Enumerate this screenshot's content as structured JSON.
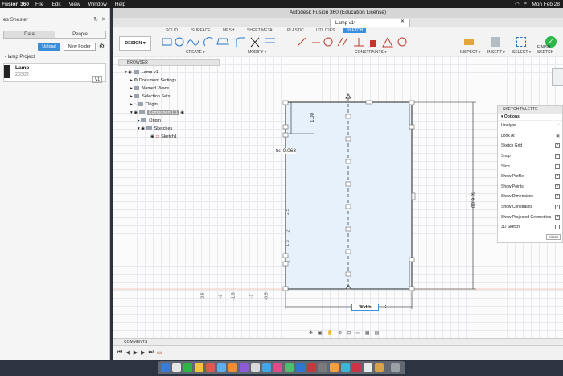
{
  "menubar": {
    "app": "Fusion 360",
    "menus": [
      "File",
      "Edit",
      "View",
      "Window",
      "Help"
    ],
    "datetime": "Mon Feb 28"
  },
  "data_panel": {
    "user": "es Shester",
    "tabs": [
      "Data",
      "People"
    ],
    "upload": "Upload",
    "new_folder": "New Folder",
    "project": "lamp Project",
    "file": {
      "name": "Lamp",
      "date": "2/23/22",
      "version": "V1"
    }
  },
  "window": {
    "title": "Autodesk Fusion 360 (Education License)",
    "doc_tab": "Lamp v1*"
  },
  "toolbar": {
    "tabs": [
      "SOLID",
      "SURFACE",
      "MESH",
      "SHEET METAL",
      "PLASTIC",
      "UTILITIES",
      "SKETCH"
    ],
    "active_tab": "SKETCH",
    "design": "DESIGN ▾",
    "groups": [
      "CREATE ▾",
      "MODIFY ▾",
      "CONSTRAINTS ▾",
      "INSPECT ▾",
      "INSERT ▾",
      "SELECT ▾",
      "FINISH SKETCH"
    ]
  },
  "browser": {
    "header": "BROWSER",
    "nodes": [
      {
        "label": "Lamp v1"
      },
      {
        "label": "Document Settings"
      },
      {
        "label": "Named Views"
      },
      {
        "label": "Selection Sets"
      },
      {
        "label": "Origin"
      },
      {
        "label": "Component1:1"
      },
      {
        "label": "Origin"
      },
      {
        "label": "Sketches"
      },
      {
        "label": "Sketch1"
      }
    ]
  },
  "sketch": {
    "dim_top": "1.00",
    "fx_label": "fx: 0.063",
    "dim_right": "fx: 6.00",
    "width_input": "Width",
    "axis_left": [
      "-2.5",
      "-2",
      "-1.5",
      "-1",
      "-0.5"
    ],
    "axis_vertical": [
      "2.5",
      "2",
      "1.5",
      "1"
    ]
  },
  "sketch_palette": {
    "title": "SKETCH PALETTE",
    "options_label": "Options",
    "rows": [
      {
        "label": "Linetype",
        "checked": false
      },
      {
        "label": "Look At",
        "checked": false
      },
      {
        "label": "Sketch Grid",
        "checked": true
      },
      {
        "label": "Snap",
        "checked": true
      },
      {
        "label": "Slice",
        "checked": false
      },
      {
        "label": "Show Profile",
        "checked": true
      },
      {
        "label": "Show Points",
        "checked": true
      },
      {
        "label": "Show Dimensions",
        "checked": true
      },
      {
        "label": "Show Constraints",
        "checked": true
      },
      {
        "label": "Show Projected Geometries",
        "checked": true
      },
      {
        "label": "3D Sketch",
        "checked": false
      }
    ],
    "finish": "Finish"
  },
  "comments": "COMMENTS",
  "colors": {
    "accent": "#3b8ee0",
    "sketch_fill": "#e6f1fb",
    "finish_green": "#2db84c"
  }
}
